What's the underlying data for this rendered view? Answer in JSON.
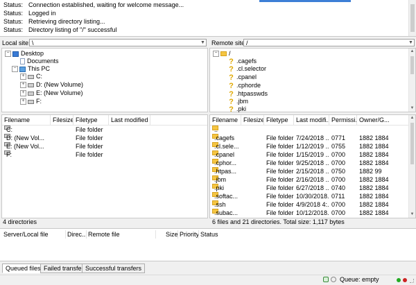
{
  "log": {
    "lines": [
      {
        "key": "Status:",
        "msg": "Connection established, waiting for welcome message..."
      },
      {
        "key": "Status:",
        "msg": "Logged in"
      },
      {
        "key": "Status:",
        "msg": "Retrieving directory listing..."
      },
      {
        "key": "Status:",
        "msg": "Directory listing of \"/\" successful"
      }
    ]
  },
  "local": {
    "site_label": "Local site:",
    "site_path": "\\",
    "tree": [
      "Desktop",
      "Documents",
      "This PC",
      "C:",
      "D: (New Volume)",
      "E: (New Volume)",
      "F:"
    ],
    "headers": [
      "Filename",
      "Filesize",
      "Filetype",
      "Last modified"
    ],
    "files": [
      {
        "name": "C:",
        "type": "File folder"
      },
      {
        "name": "D: (New Vol...",
        "type": "File folder"
      },
      {
        "name": "E: (New Vol...",
        "type": "File folder"
      },
      {
        "name": "F:",
        "type": "File folder"
      }
    ],
    "status": "4 directories"
  },
  "remote": {
    "site_label": "Remote site:",
    "site_path": "/",
    "tree": [
      "/",
      ".cagefs",
      ".cl.selector",
      ".cpanel",
      ".cphorde",
      ".htpasswds",
      ".jbm",
      ".pki"
    ],
    "headers": [
      "Filename",
      "Filesize",
      "Filetype",
      "Last modifi...",
      "Permissi...",
      "Owner/G..."
    ],
    "files": [
      {
        "name": "..",
        "type": "",
        "modified": "",
        "perm": "",
        "owner": ""
      },
      {
        "name": ".cagefs",
        "type": "File folder",
        "modified": "7/24/2018 ...",
        "perm": "0771",
        "owner": "1882 1884"
      },
      {
        "name": ".cl.sele...",
        "type": "File folder",
        "modified": "1/12/2019 ...",
        "perm": "0755",
        "owner": "1882 1884"
      },
      {
        "name": ".cpanel",
        "type": "File folder",
        "modified": "1/15/2019 ...",
        "perm": "0700",
        "owner": "1882 1884"
      },
      {
        "name": ".cphor...",
        "type": "File folder",
        "modified": "9/25/2018 ...",
        "perm": "0700",
        "owner": "1882 1884"
      },
      {
        "name": ".htpas...",
        "type": "File folder",
        "modified": "2/15/2018 ...",
        "perm": "0750",
        "owner": "1882 99"
      },
      {
        "name": ".jbm",
        "type": "File folder",
        "modified": "2/16/2018 ...",
        "perm": "0700",
        "owner": "1882 1884"
      },
      {
        "name": ".pki",
        "type": "File folder",
        "modified": "6/27/2018 ...",
        "perm": "0740",
        "owner": "1882 1884"
      },
      {
        "name": ".softac...",
        "type": "File folder",
        "modified": "10/30/2018...",
        "perm": "0711",
        "owner": "1882 1884"
      },
      {
        "name": ".ssh",
        "type": "File folder",
        "modified": "4/9/2018 4:...",
        "perm": "0700",
        "owner": "1882 1884"
      },
      {
        "name": ".subac...",
        "type": "File folder",
        "modified": "10/12/2018...",
        "perm": "0700",
        "owner": "1882 1884"
      }
    ],
    "status": "6 files and 21 directories. Total size: 1,117 bytes"
  },
  "queue": {
    "headers": [
      "Server/Local file",
      "Direc...",
      "Remote file",
      "Size",
      "Priority",
      "Status"
    ]
  },
  "tabs": [
    "Queued files",
    "Failed transfers",
    "Successful transfers"
  ],
  "statusbar": {
    "queue": "Queue: empty"
  },
  "colors": {
    "folder": "#f5c542",
    "accent": "#3d7fd6",
    "led_green": "#22aa22",
    "led_red": "#cc2222"
  }
}
